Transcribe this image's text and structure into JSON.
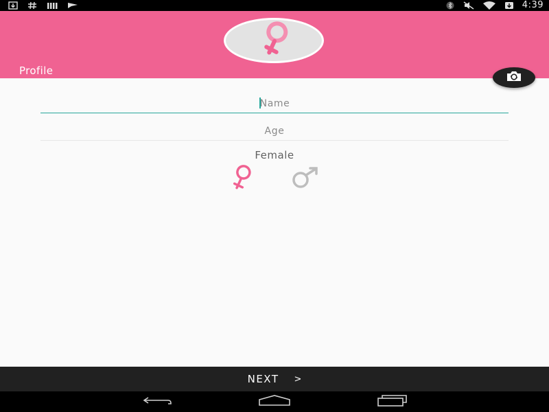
{
  "status_bar": {
    "time": "4:39",
    "left_icons": [
      "download-icon",
      "hash-icon",
      "signal-bars-icon",
      "flag-icon"
    ],
    "right_icons": [
      "bluetooth-icon",
      "mute-icon",
      "wifi-icon",
      "battery-icon"
    ]
  },
  "header": {
    "title": "Profile",
    "avatar_icon": "female-symbol-icon",
    "camera_icon": "camera-switch-icon",
    "color": "#f06292"
  },
  "form": {
    "name_placeholder": "Name",
    "age_placeholder": "Age",
    "gender_label": "Female",
    "gender_options": [
      {
        "icon": "female-symbol-icon",
        "selected": true,
        "color": "#f06292"
      },
      {
        "icon": "male-symbol-icon",
        "selected": false,
        "color": "#bdbdbd"
      }
    ]
  },
  "next": {
    "label": "NEXT",
    "arrow": ">"
  },
  "nav": {
    "icons": [
      "back-icon",
      "home-icon",
      "recents-icon"
    ]
  },
  "colors": {
    "accent": "#26a69a",
    "toolbar_dark": "#212121"
  }
}
